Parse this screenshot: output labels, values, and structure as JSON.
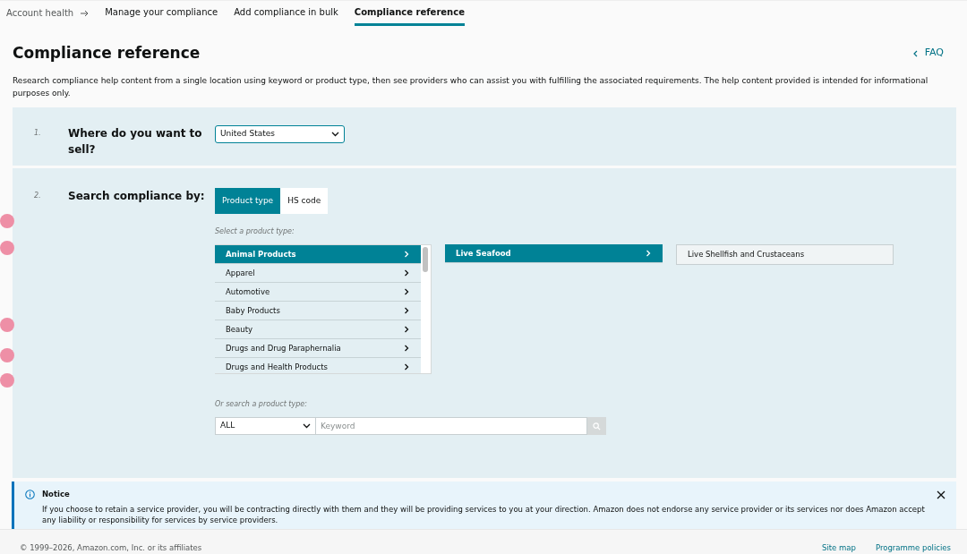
{
  "breadcrumb": {
    "root": "Account health"
  },
  "tabs": [
    {
      "label": "Manage your compliance",
      "selected": false
    },
    {
      "label": "Add compliance in bulk",
      "selected": false
    },
    {
      "label": "Compliance reference",
      "selected": true
    }
  ],
  "page": {
    "title": "Compliance reference",
    "faq_link": "FAQ",
    "description": "Research compliance help content from a single location using keyword or product type, then see providers who can assist you with fulfilling the associated requirements. The help content provided is intended for informational purposes only."
  },
  "step1": {
    "number": "1.",
    "label": "Where do you want to sell?",
    "marketplace": "United States"
  },
  "step2": {
    "number": "2.",
    "label": "Search compliance by:",
    "search_modes": [
      {
        "label": "Product type",
        "selected": true
      },
      {
        "label": "HS code",
        "selected": false
      }
    ],
    "select_hint": "Select a product type:",
    "columns": [
      [
        {
          "label": "Animal Products",
          "selected": true
        },
        {
          "label": "Apparel",
          "selected": false
        },
        {
          "label": "Automotive",
          "selected": false
        },
        {
          "label": "Baby Products",
          "selected": false
        },
        {
          "label": "Beauty",
          "selected": false
        },
        {
          "label": "Drugs and Drug Paraphernalia",
          "selected": false
        },
        {
          "label": "Drugs and Health Products",
          "selected": false
        }
      ],
      [
        {
          "label": "Live Seafood",
          "selected": true
        }
      ],
      [
        {
          "label": "Live Shellfish and Crustaceans",
          "selected": false,
          "kind": "leaf"
        }
      ]
    ],
    "search_hint": "Or search a product type:",
    "category_filter": "ALL",
    "keyword_placeholder": "Keyword"
  },
  "notice": {
    "title": "Notice",
    "text": "If you choose to retain a service provider, you will be contracting directly with them and they will be providing services to you at your direction. Amazon does not endorse any service provider or its services nor does Amazon accept any liability or responsibility for services by service providers."
  },
  "footer": {
    "copyright": "© 1999–2026, Amazon.com, Inc. or its affiliates",
    "links": [
      "Site map",
      "Programme policies"
    ]
  }
}
